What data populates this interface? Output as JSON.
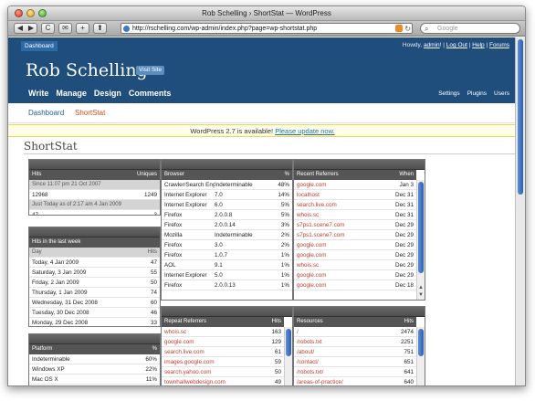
{
  "window": {
    "title": "Rob Schelling › ShortStat — WordPress"
  },
  "browser": {
    "url": "http://rschelling.com/wp-admin/index.php?page=wp-shortstat.php",
    "search_placeholder": "Google",
    "back": "◀",
    "forward": "▶",
    "reload": "C",
    "bookmark": "✉",
    "add": "+",
    "home": "⬆"
  },
  "wp": {
    "dashboard_tab": "Dashboard",
    "howdy_prefix": "Howdy,",
    "user": "admin",
    "bang": "!",
    "logout": "Log Out",
    "help": "Help",
    "forums": "Forums",
    "sep": "|",
    "blog_name": "Rob Schelling",
    "visit_site": "Visit Site",
    "nav": [
      "Write",
      "Manage",
      "Design",
      "Comments"
    ],
    "nav_right": [
      "Settings",
      "Plugins",
      "Users"
    ],
    "submenu": [
      "Dashboard",
      "ShortStat"
    ],
    "update_text": "WordPress 2.7 is available!",
    "update_link": "Please update now.",
    "page_title": "ShortStat"
  },
  "hits": {
    "header": [
      "Hits",
      "Uniques"
    ],
    "since": "Since 11:07 pm 21 Oct 2007",
    "since_vals": [
      "12968",
      "1249"
    ],
    "today": "Just Today as of 2:17 am 4 Jan 2009",
    "today_vals": [
      "47",
      "3"
    ]
  },
  "week": {
    "title": "Hits in the last week",
    "header": [
      "Day",
      "Hits"
    ],
    "rows": [
      [
        "Today, 4 Jan 2009",
        "47"
      ],
      [
        "Saturday, 3 Jan 2009",
        "55"
      ],
      [
        "Friday, 2 Jan 2009",
        "50"
      ],
      [
        "Thursday, 1 Jan 2009",
        "74"
      ],
      [
        "Wednesday, 31 Dec 2008",
        "60"
      ],
      [
        "Tuesday, 30 Dec 2008",
        "46"
      ],
      [
        "Monday, 29 Dec 2008",
        "33"
      ]
    ]
  },
  "platform": {
    "header": [
      "Platform",
      "%"
    ],
    "rows": [
      [
        "Indeterminable",
        "60%"
      ],
      [
        "Windows XP",
        "22%"
      ],
      [
        "Mac OS X",
        "11%"
      ]
    ]
  },
  "browsers": {
    "header": [
      "Browser",
      "%"
    ],
    "rows": [
      [
        "Crawler/Search Engine",
        "Indeterminable",
        "48%"
      ],
      [
        "Internet Explorer",
        "7.0",
        "14%"
      ],
      [
        "Internet Explorer",
        "6.0",
        "5%"
      ],
      [
        "Firefox",
        "2.0.0.8",
        "5%"
      ],
      [
        "Firefox",
        "2.0.0.14",
        "3%"
      ],
      [
        "Mozilla",
        "Indeterminable",
        "2%"
      ],
      [
        "Firefox",
        "3.0",
        "2%"
      ],
      [
        "Firefox",
        "1.0.7",
        "1%"
      ],
      [
        "AOL",
        "9.1",
        "1%"
      ],
      [
        "Internet Explorer",
        "5.0",
        "1%"
      ],
      [
        "Firefox",
        "2.0.0.13",
        "1%"
      ]
    ]
  },
  "referrers": {
    "header": [
      "Recent Referrers",
      "When"
    ],
    "rows": [
      [
        "google.com",
        "Jan 3"
      ],
      [
        "localhost",
        "Dec 31"
      ],
      [
        "search.live.com",
        "Dec 31"
      ],
      [
        "whois.sc",
        "Dec 31"
      ],
      [
        "s7ps1.scene7.com",
        "Dec 29"
      ],
      [
        "s7ps1.scene7.com",
        "Dec 29"
      ],
      [
        "google.com",
        "Dec 29"
      ],
      [
        "google.com",
        "Dec 29"
      ],
      [
        "whois.sc",
        "Dec 29"
      ],
      [
        "google.com",
        "Dec 29"
      ],
      [
        "google.com",
        "Dec 18"
      ]
    ]
  },
  "repeat": {
    "header": [
      "Repeat Referrers",
      "Hits"
    ],
    "rows": [
      [
        "whois.sc",
        "163"
      ],
      [
        "google.com",
        "129"
      ],
      [
        "search.live.com",
        "61"
      ],
      [
        "images.google.com",
        "59"
      ],
      [
        "search.yahoo.com",
        "50"
      ],
      [
        "townhallwebdesign.com",
        "49"
      ]
    ]
  },
  "resources": {
    "header": [
      "Resources",
      "Hits"
    ],
    "rows": [
      [
        "/",
        "2474"
      ],
      [
        "/robots.txt",
        "2251"
      ],
      [
        "/about/",
        "751"
      ],
      [
        "/contact/",
        "651"
      ],
      [
        "/robots.txt/",
        "641"
      ],
      [
        "/areas-of-practice/",
        "640"
      ]
    ]
  }
}
